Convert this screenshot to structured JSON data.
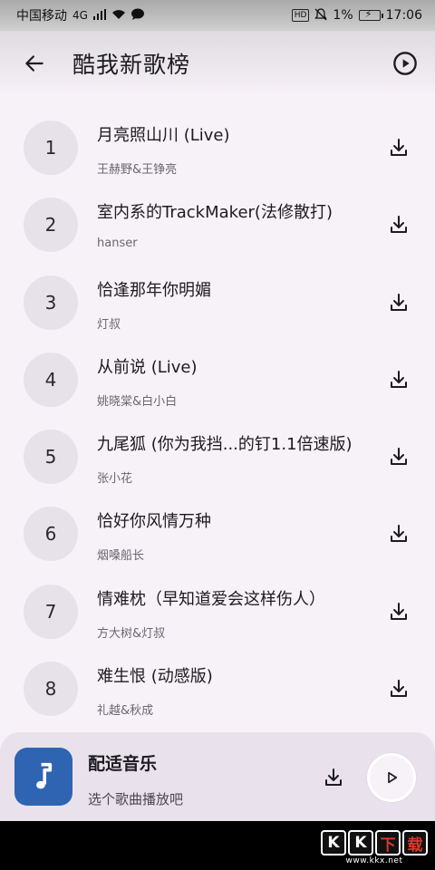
{
  "status_bar": {
    "carrier": "中国移动",
    "network": "4G",
    "battery_percent": "1%",
    "time": "17:06",
    "hd": "HD"
  },
  "header": {
    "title": "酷我新歌榜"
  },
  "songs": [
    {
      "rank": "1",
      "title": "月亮照山川 (Live)",
      "artist": "王赫野&王铮亮"
    },
    {
      "rank": "2",
      "title": "室内系的TrackMaker(法修散打)",
      "artist": "hanser"
    },
    {
      "rank": "3",
      "title": "恰逢那年你明媚",
      "artist": "灯叔"
    },
    {
      "rank": "4",
      "title": "从前说 (Live)",
      "artist": "姚晓棠&白小白"
    },
    {
      "rank": "5",
      "title": "九尾狐 (你为我挡...的钉1.1倍速版)",
      "artist": "张小花"
    },
    {
      "rank": "6",
      "title": "恰好你风情万种",
      "artist": "烟嗓船长"
    },
    {
      "rank": "7",
      "title": "情难枕（早知道爱会这样伤人）",
      "artist": "方大树&灯叔"
    },
    {
      "rank": "8",
      "title": "难生恨 (动感版)",
      "artist": "礼越&秋成"
    }
  ],
  "player": {
    "title": "配适音乐",
    "subtitle": "选个歌曲播放吧"
  },
  "watermark": {
    "chars": [
      "K",
      "K",
      "下",
      "载"
    ],
    "url": "www.kkx.net"
  },
  "colors": {
    "background": "#f7f1f8",
    "rank_circle": "#e7e1e9",
    "player_bar": "#e9e2ec",
    "album_art": "#2f64b3"
  },
  "icons": {
    "back": "arrow-left-icon",
    "play_all": "play-circle-icon",
    "download": "download-icon",
    "album": "music-note-icon",
    "player_play": "play-icon"
  }
}
